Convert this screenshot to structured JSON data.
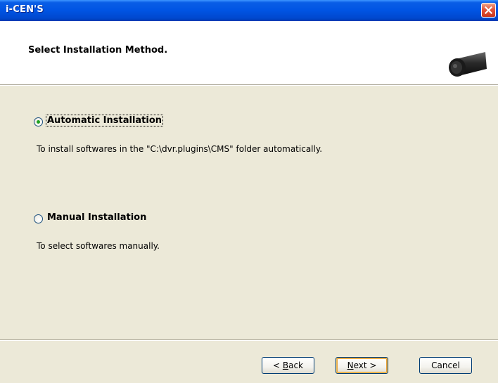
{
  "window": {
    "title": "i-CEN'S"
  },
  "header": {
    "title": "Select Installation Method."
  },
  "options": [
    {
      "label": "Automatic Installation",
      "description": "To install softwares in the \"C:\\dvr.plugins\\CMS\" folder automatically.",
      "selected": true
    },
    {
      "label": "Manual Installation",
      "description": "To select softwares manually.",
      "selected": false
    }
  ],
  "buttons": {
    "back": {
      "prefix": "< ",
      "mnemonic": "B",
      "rest": "ack"
    },
    "next": {
      "mnemonic": "N",
      "rest": "ext >"
    },
    "cancel": "Cancel"
  },
  "colors": {
    "titlebar": "#0054e3",
    "dialog_bg": "#ece9d8",
    "close_button": "#e2553a",
    "radio_checked": "#21a121"
  },
  "icons": {
    "camera": "camera-icon",
    "close": "close-icon"
  }
}
